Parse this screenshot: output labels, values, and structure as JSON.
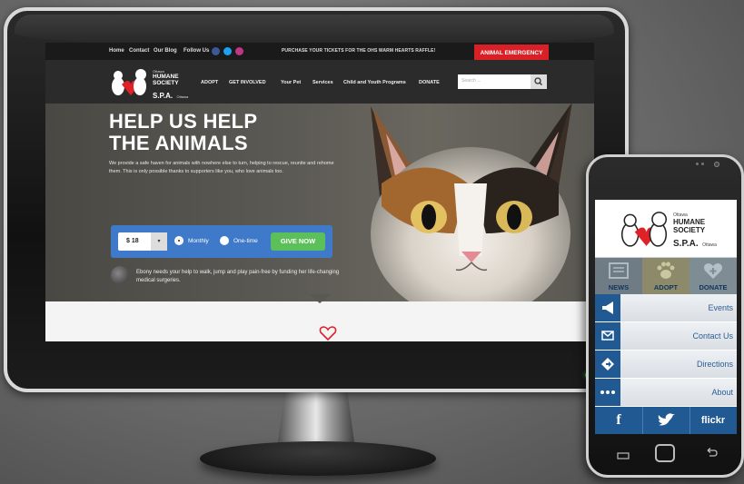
{
  "desktop": {
    "topbar": {
      "links": [
        "Home",
        "Contact",
        "Our Blog",
        "Follow Us"
      ],
      "raffle": "PURCHASE YOUR TICKETS FOR THE OHS WARM HEARTS RAFFLE!",
      "emergency": "ANIMAL EMERGENCY"
    },
    "logo": {
      "city": "Ottawa",
      "line1": "HUMANE",
      "line2": "SOCIETY",
      "spa": "S.P.A.",
      "city_fr": "Ottawa"
    },
    "nav": [
      "ADOPT",
      "GET INVOLVED",
      "Your Pet",
      "Services",
      "Child and Youth Programs",
      "DONATE"
    ],
    "search": {
      "placeholder": "Search ..."
    },
    "hero": {
      "title_line1": "HELP US HELP",
      "title_line2": "THE ANIMALS",
      "text": "We provide a safe haven for animals with nowhere else to turn, helping to rescue, reunite and rehome them. This is only possible thanks to supporters like you, who love animals too."
    },
    "donate": {
      "amount": "$ 18",
      "monthly": "Monthly",
      "one_time": "One-time",
      "give_now": "GIVE NOW"
    },
    "ebony": "Ebony needs your help to walk, jump and play pain-free by funding her life-changing medical surgeries."
  },
  "phone": {
    "logo": {
      "city": "Ottawa",
      "line1": "HUMANE",
      "line2": "SOCIETY",
      "spa": "S.P.A.",
      "city_fr": "Ottawa"
    },
    "tiles": [
      {
        "label": "NEWS",
        "icon": "newspaper-icon",
        "color": "#6f7c86"
      },
      {
        "label": "ADOPT",
        "icon": "paw-icon",
        "color": "#8c8a6a"
      },
      {
        "label": "DONATE",
        "icon": "heart-plus-icon",
        "color": "#7e8c94"
      }
    ],
    "menu": [
      {
        "label": "Events",
        "icon": "megaphone-icon"
      },
      {
        "label": "Contact Us",
        "icon": "envelope-icon"
      },
      {
        "label": "Directions",
        "icon": "directions-icon"
      },
      {
        "label": "About",
        "icon": "ellipsis-icon"
      }
    ],
    "social": [
      "f",
      "twitter-bird-icon",
      "flickr"
    ]
  },
  "colors": {
    "emergency_red": "#d92026",
    "donate_blue": "#3f79c9",
    "give_green": "#5cc05a",
    "phone_blue": "#215a93"
  }
}
